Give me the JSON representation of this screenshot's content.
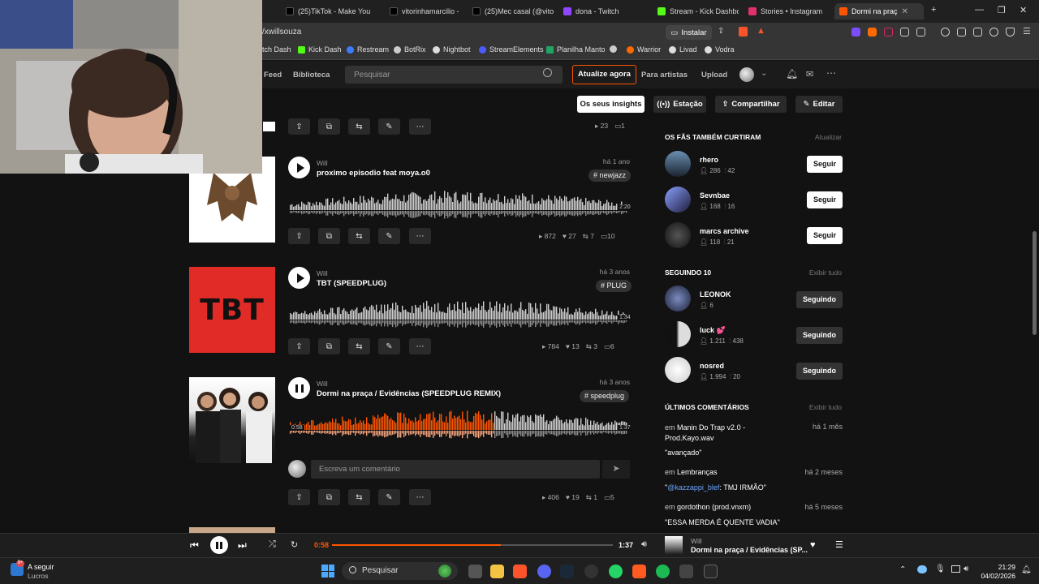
{
  "browser": {
    "tabs": [
      {
        "label": "(25)TikTok - Make You",
        "color": "#000000"
      },
      {
        "label": "vitorinhamarcilio -",
        "color": "#000000"
      },
      {
        "label": "(25)Mec casal (@vitori",
        "color": "#000000"
      },
      {
        "label": "dona - Twitch",
        "color": "#9146ff"
      },
      {
        "label": "Stream - Kick Dashboa",
        "color": "#53fc18"
      },
      {
        "label": "Stories • Instagram",
        "color": "#e1306c"
      },
      {
        "label": "Dormi na praç",
        "color": "#ff5500"
      }
    ],
    "address": "/xwillsouza",
    "install_label": "Instalar",
    "bookmarks": [
      {
        "label": "tch Dash",
        "color": "#9146ff"
      },
      {
        "label": "Kick Dash",
        "color": "#53fc18"
      },
      {
        "label": "Restream",
        "color": "#3c7cff"
      },
      {
        "label": "BotRix",
        "color": "#cccccc"
      },
      {
        "label": "Nightbot",
        "color": "#dddddd"
      },
      {
        "label": "StreamElements",
        "color": "#4b5cff"
      },
      {
        "label": "Planilha Manto",
        "color": "#1fa463"
      },
      {
        "label": "",
        "color": "#cccccc"
      },
      {
        "label": "Warrior",
        "color": "#ff6a00"
      },
      {
        "label": "Livad",
        "color": "#dddddd"
      },
      {
        "label": "Vodra",
        "color": "#dddddd"
      }
    ]
  },
  "header": {
    "nav": [
      "Feed",
      "Biblioteca"
    ],
    "search_placeholder": "Pesquisar",
    "upgrade": "Atualize agora",
    "for_artists": "Para artistas",
    "upload": "Upload"
  },
  "actions": {
    "insights": "Os seus insights",
    "station": "Estação",
    "share": "Compartilhar",
    "edit": "Editar"
  },
  "tracks": [
    {
      "uploader": "Will",
      "title": "proximo episodio feat moya.o0",
      "ago": "há 1 ano",
      "tag": "# newjazz",
      "duration": "2:20",
      "plays": "872",
      "likes": "27",
      "reposts": "7",
      "comments": "10",
      "progress": 0
    },
    {
      "uploader": "Will",
      "title": "TBT (SPEEDPLUG)",
      "ago": "há 3 anos",
      "tag": "# PLUG",
      "duration": "1:34",
      "plays": "784",
      "likes": "13",
      "reposts": "3",
      "comments": "6",
      "progress": 0
    },
    {
      "uploader": "Will",
      "title": "Dormi na praça / Evidências (SPEEDPLUG REMIX)",
      "ago": "há 3 anos",
      "tag": "# speedplug",
      "duration": "1:37",
      "elapsed": "0:58",
      "plays": "406",
      "likes": "19",
      "reposts": "1",
      "comments": "5",
      "progress": 0.6
    }
  ],
  "top_track_stats": {
    "likes": "23",
    "comments": "1"
  },
  "art_text": "TBT",
  "comment_placeholder": "Escreva um comentário",
  "sidebar": {
    "fans_title": "OS FÃS TAMBÉM CURTIRAM",
    "fans_link": "Atualizar",
    "fans": [
      {
        "name": "rhero",
        "followers": "286",
        "tracks": "42",
        "button": "Seguir"
      },
      {
        "name": "Sevnbae",
        "followers": "168",
        "tracks": "16",
        "button": "Seguir"
      },
      {
        "name": "marcs archive",
        "followers": "118",
        "tracks": "21",
        "button": "Seguir"
      }
    ],
    "following_title": "SEGUINDO 10",
    "following_link": "Exibir tudo",
    "following": [
      {
        "name": "LEONOK",
        "followers": "6",
        "tracks": "",
        "button": "Seguindo"
      },
      {
        "name": "luck 💕",
        "followers": "1.211",
        "tracks": "438",
        "button": "Seguindo"
      },
      {
        "name": "nosred",
        "followers": "1.994",
        "tracks": "20",
        "button": "Seguindo"
      }
    ],
    "comments_title": "ÚLTIMOS COMENTÁRIOS",
    "comments_link": "Exibir tudo",
    "comments": [
      {
        "on_prefix": "em",
        "track": "Manin Do Trap v2.0 - Prod.Kayo.wav",
        "ago": "há 1 mês",
        "text": "\"avançado\""
      },
      {
        "on_prefix": "em",
        "track": "Lembranças",
        "ago": "há 2 meses",
        "mention": "@kazzappi_blef",
        "text": ": TMJ IRMÃO\"",
        "quote_open": "\""
      },
      {
        "on_prefix": "em",
        "track": "gordothon (prod.vnxm)",
        "ago": "há 5 meses",
        "text": "\"ESSA MERDA É QUENTE VADIA\""
      }
    ]
  },
  "player": {
    "elapsed": "0:58",
    "total": "1:37",
    "progress": 0.6,
    "artist": "Will",
    "title": "Dormi na praça / Evidências (SP..."
  },
  "taskbar": {
    "weather_title": "A seguir",
    "weather_sub": "Lucros",
    "search": "Pesquisar",
    "time": "21:29",
    "date": "04/02/2026"
  }
}
